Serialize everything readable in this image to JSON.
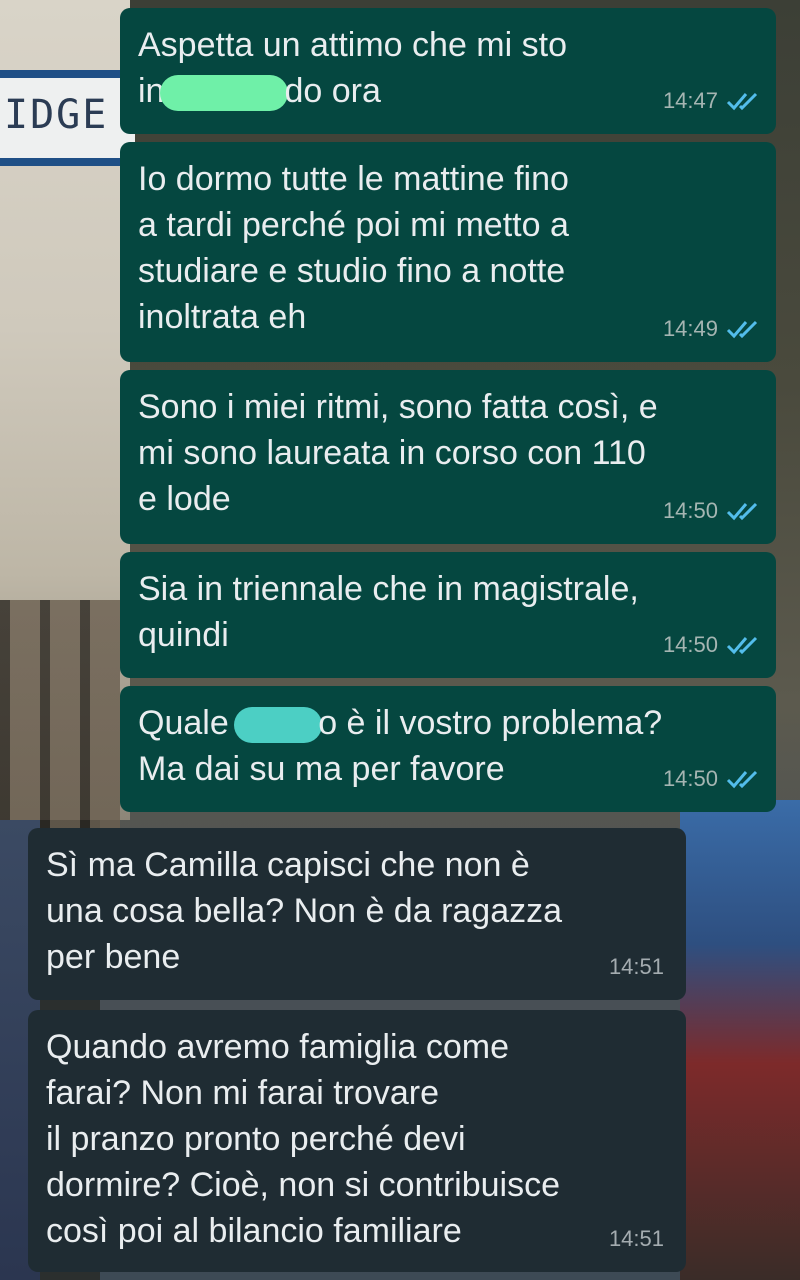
{
  "messages": [
    {
      "dir": "out",
      "parts": [
        "Aspetta un attimo che mi sto\nin",
        "do ora"
      ],
      "time": "14:47",
      "status": "read"
    },
    {
      "dir": "out",
      "parts": [
        "Io dormo tutte le mattine fino\na tardi perché poi mi metto a\nstudiare e studio fino a notte\ninoltrata eh"
      ],
      "time": "14:49",
      "status": "read"
    },
    {
      "dir": "out",
      "parts": [
        "Sono i miei ritmi, sono fatta così, e\nmi sono laureata in corso con 110\ne lode"
      ],
      "time": "14:50",
      "status": "read"
    },
    {
      "dir": "out",
      "parts": [
        "Sia in triennale che in magistrale,\nquindi"
      ],
      "time": "14:50",
      "status": "read"
    },
    {
      "dir": "out",
      "parts": [
        "Quale ",
        "o è il vostro problema?\nMa dai su ma per favore"
      ],
      "time": "14:50",
      "status": "read"
    },
    {
      "dir": "in",
      "parts": [
        "Sì ma Camilla capisci che non è\nuna cosa bella? Non è da ragazza\nper bene"
      ],
      "time": "14:51"
    },
    {
      "dir": "in",
      "parts": [
        "Quando avremo famiglia come\nfarai? Non mi farai trovare\nil pranzo pronto perché devi\ndormire? Cioè, non si contribuisce\ncosì poi al bilancio familiare"
      ],
      "time": "14:51"
    }
  ],
  "background": {
    "sign_text": "IDGE"
  },
  "colors": {
    "outgoing": "#054740",
    "incoming": "#1f2c33",
    "read_tick": "#53bdeb",
    "redaction_1": "#6ff0a8",
    "redaction_2": "#4ccfc4"
  }
}
